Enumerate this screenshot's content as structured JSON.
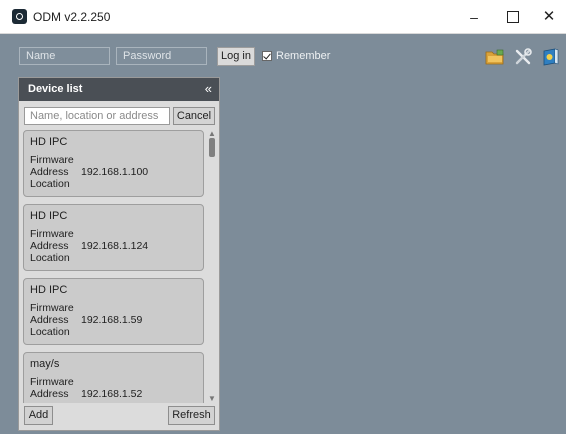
{
  "window": {
    "title": "ODM v2.2.250",
    "minimize": "–",
    "close": "✕"
  },
  "login": {
    "name_placeholder": "Name",
    "password_placeholder": "Password",
    "login_label": "Log in",
    "remember_label": "Remember",
    "remember_checked": true
  },
  "toolbar": {
    "icons": [
      "folder-icon",
      "tools-icon",
      "help-book-icon"
    ]
  },
  "device_list": {
    "title": "Device list",
    "collapse": "«",
    "search_placeholder": "Name, location or address",
    "cancel_label": "Cancel",
    "labels": {
      "firmware": "Firmware",
      "address": "Address",
      "location": "Location"
    },
    "devices": [
      {
        "name": "HD IPC",
        "address": "192.168.1.100"
      },
      {
        "name": "HD IPC",
        "address": "192.168.1.124"
      },
      {
        "name": "HD IPC",
        "address": "192.168.1.59"
      },
      {
        "name": "may/s",
        "address": "192.168.1.52"
      }
    ],
    "add_label": "Add",
    "refresh_label": "Refresh"
  },
  "colors": {
    "workspace": "#7d8c99",
    "panel_header": "#4a4f55",
    "card": "#cbcbcb"
  }
}
